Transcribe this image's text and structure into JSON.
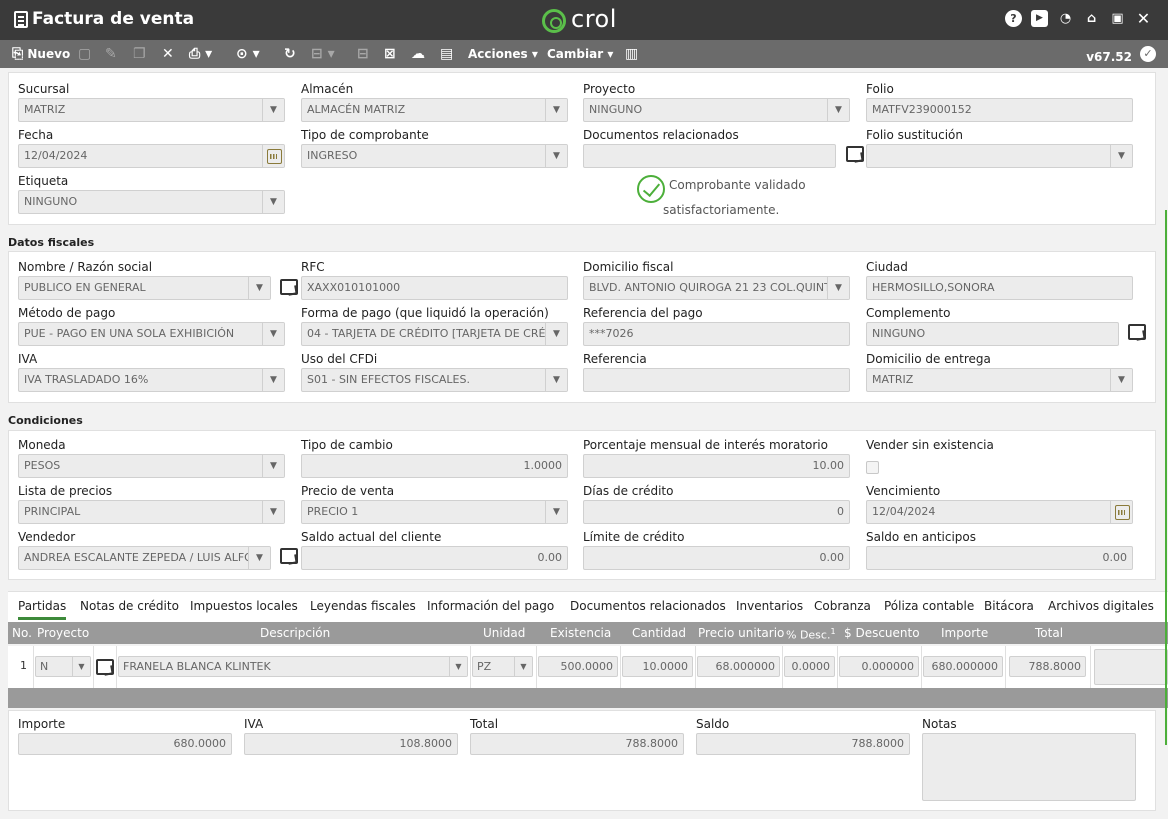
{
  "window": {
    "title": "Factura de venta",
    "logo": "crol",
    "version": "v67.52"
  },
  "toolbar": {
    "nuevo": "Nuevo",
    "acciones": "Acciones",
    "cambiar": "Cambiar"
  },
  "general": {
    "sucursal_label": "Sucursal",
    "sucursal": "MATRIZ",
    "almacen_label": "Almacén",
    "almacen": "ALMACÉN MATRIZ",
    "proyecto_label": "Proyecto",
    "proyecto": "NINGUNO",
    "folio_label": "Folio",
    "folio": "MATFV239000152",
    "fecha_label": "Fecha",
    "fecha": "12/04/2024",
    "tipo_comprobante_label": "Tipo de comprobante",
    "tipo_comprobante": "INGRESO",
    "docs_relacionados_label": "Documentos relacionados",
    "docs_relacionados": "",
    "folio_sustitucion_label": "Folio sustitución",
    "folio_sustitucion": "",
    "etiqueta_label": "Etiqueta",
    "etiqueta": "NINGUNO",
    "validacion_linea1": "Comprobante validado",
    "validacion_linea2": "satisfactoriamente."
  },
  "fiscales": {
    "section_title": "Datos fiscales",
    "razon_social_label": "Nombre / Razón social",
    "razon_social": "PUBLICO EN GENERAL",
    "rfc_label": "RFC",
    "rfc": "XAXX010101000",
    "domicilio_label": "Domicilio fiscal",
    "domicilio": "BLVD. ANTONIO QUIROGA 21 23 COL.QUINTA",
    "ciudad_label": "Ciudad",
    "ciudad": "HERMOSILLO,SONORA",
    "metodo_pago_label": "Método de pago",
    "metodo_pago": "PUE - PAGO EN UNA SOLA EXHIBICIÓN",
    "forma_pago_label": "Forma de pago (que liquidó la operación)",
    "forma_pago": "04 - TARJETA DE CRÉDITO [TARJETA DE CRÉDITO]",
    "referencia_pago_label": "Referencia del pago",
    "referencia_pago": "***7026",
    "complemento_label": "Complemento",
    "complemento": "NINGUNO",
    "iva_label": "IVA",
    "iva": "IVA TRASLADADO 16%",
    "uso_cfdi_label": "Uso del CFDi",
    "uso_cfdi": "S01 - SIN EFECTOS FISCALES.",
    "referencia_label": "Referencia",
    "referencia": "",
    "domicilio_entrega_label": "Domicilio de entrega",
    "domicilio_entrega": "MATRIZ"
  },
  "condiciones": {
    "section_title": "Condiciones",
    "moneda_label": "Moneda",
    "moneda": "PESOS",
    "tipo_cambio_label": "Tipo de cambio",
    "tipo_cambio": "1.0000",
    "interes_label": "Porcentaje mensual de interés moratorio",
    "interes": "10.00",
    "sin_existencia_label": "Vender sin existencia",
    "lista_precios_label": "Lista de precios",
    "lista_precios": "PRINCIPAL",
    "precio_venta_label": "Precio de venta",
    "precio_venta": "PRECIO 1",
    "dias_credito_label": "Días de crédito",
    "dias_credito": "0",
    "vencimiento_label": "Vencimiento",
    "vencimiento": "12/04/2024",
    "vendedor_label": "Vendedor",
    "vendedor": "ANDREA ESCALANTE ZEPEDA / LUIS ALFONSO",
    "saldo_cliente_label": "Saldo actual del cliente",
    "saldo_cliente": "0.00",
    "limite_credito_label": "Límite de crédito",
    "limite_credito": "0.00",
    "saldo_anticipos_label": "Saldo en anticipos",
    "saldo_anticipos": "0.00"
  },
  "tabs": [
    "Partidas",
    "Notas de crédito",
    "Impuestos locales",
    "Leyendas fiscales",
    "Información del pago",
    "Documentos relacionados",
    "Inventarios",
    "Cobranza",
    "Póliza contable",
    "Bitácora",
    "Archivos digitales"
  ],
  "grid": {
    "headers": [
      "No.",
      "Proyecto",
      "Descripción",
      "Unidad",
      "Existencia",
      "Cantidad",
      "Precio unitario",
      "% Desc.",
      "$ Descuento",
      "Importe",
      "Total"
    ],
    "desc_superscript": "1",
    "row": {
      "no": "1",
      "proyecto": "N",
      "descripcion": "FRANELA BLANCA KLINTEK",
      "unidad": "PZ",
      "existencia": "500.0000",
      "cantidad": "10.0000",
      "precio_unitario": "68.000000",
      "pct_desc": "0.0000",
      "descuento": "0.000000",
      "importe": "680.000000",
      "total": "788.8000"
    }
  },
  "totales": {
    "importe_label": "Importe",
    "importe": "680.0000",
    "iva_label": "IVA",
    "iva": "108.8000",
    "total_label": "Total",
    "total": "788.8000",
    "saldo_label": "Saldo",
    "saldo": "788.8000",
    "notas_label": "Notas"
  }
}
